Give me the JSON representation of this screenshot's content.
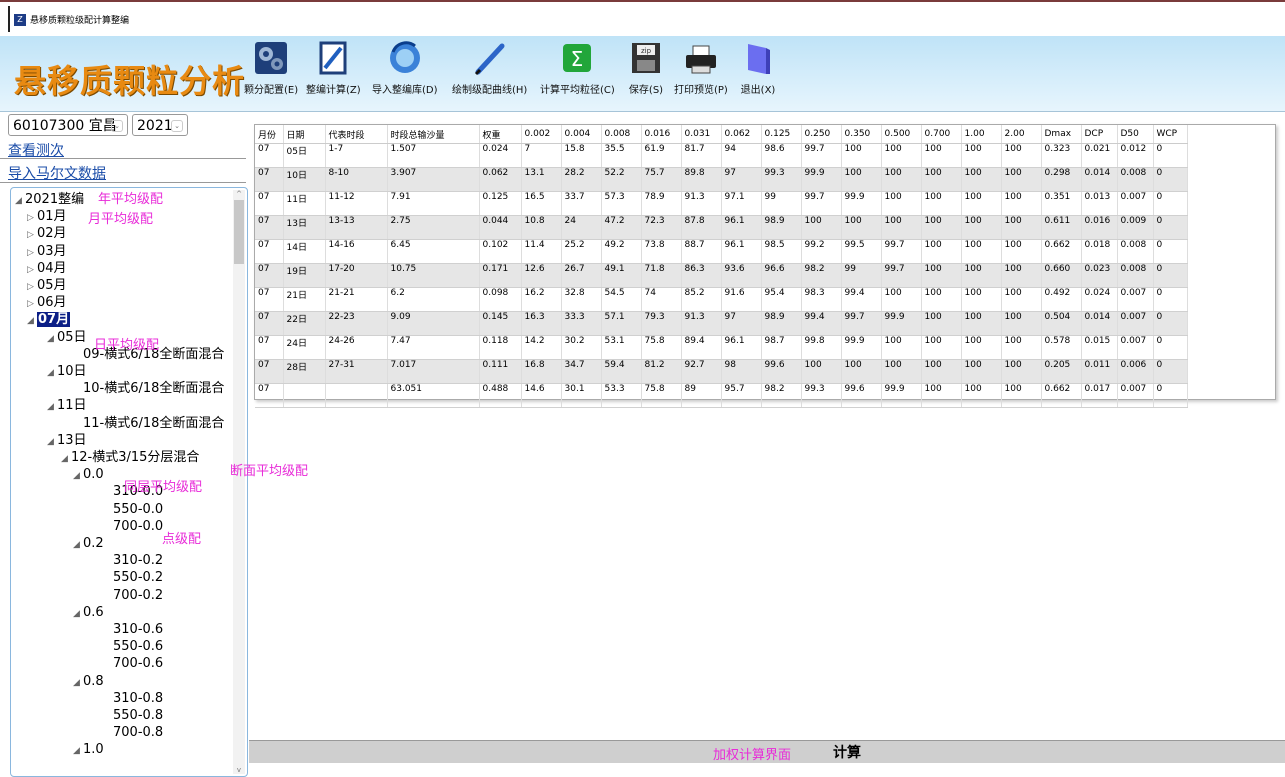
{
  "window": {
    "title": "悬移质颗粒级配计算整编"
  },
  "app_title": "悬移质颗粒分析",
  "toolbar": [
    {
      "id": "config",
      "label": "颗分配置(E)",
      "icon": "gear-cube-icon"
    },
    {
      "id": "compile",
      "label": "整编计算(Z)",
      "icon": "document-edit-icon"
    },
    {
      "id": "import",
      "label": "导入整编库(D)",
      "icon": "refresh-globe-icon"
    },
    {
      "id": "curve",
      "label": "绘制级配曲线(H)",
      "icon": "pen-icon"
    },
    {
      "id": "avg",
      "label": "计算平均粒径(C)",
      "icon": "sigma-icon"
    },
    {
      "id": "save",
      "label": "保存(S)",
      "icon": "floppy-zip-icon"
    },
    {
      "id": "print",
      "label": "打印预览(P)",
      "icon": "printer-icon"
    },
    {
      "id": "exit",
      "label": "退出(X)",
      "icon": "exit-book-icon"
    }
  ],
  "station": "60107300 宜昌",
  "year": "2021",
  "links": {
    "view_measure": "查看测次",
    "import_malvern": "导入马尔文数据"
  },
  "tree": [
    {
      "label": "2021整编",
      "exp": "◢",
      "level": 0
    },
    {
      "label": "01月",
      "exp": "▷",
      "level": 1
    },
    {
      "label": "02月",
      "exp": "▷",
      "level": 1
    },
    {
      "label": "03月",
      "exp": "▷",
      "level": 1
    },
    {
      "label": "04月",
      "exp": "▷",
      "level": 1
    },
    {
      "label": "05月",
      "exp": "▷",
      "level": 1
    },
    {
      "label": "06月",
      "exp": "▷",
      "level": 1
    },
    {
      "label": "07月",
      "exp": "◢",
      "level": 1,
      "selected": true
    },
    {
      "label": "05日",
      "exp": "◢",
      "level": 2
    },
    {
      "label": "09-横式6/18全断面混合",
      "exp": "",
      "level": 3
    },
    {
      "label": "10日",
      "exp": "◢",
      "level": 2
    },
    {
      "label": "10-横式6/18全断面混合",
      "exp": "",
      "level": 3
    },
    {
      "label": "11日",
      "exp": "◢",
      "level": 2
    },
    {
      "label": "11-横式6/18全断面混合",
      "exp": "",
      "level": 3
    },
    {
      "label": "13日",
      "exp": "◢",
      "level": 2
    },
    {
      "label": "12-横式3/15分层混合",
      "exp": "◢",
      "level": 3
    },
    {
      "label": "0.0",
      "exp": "◢",
      "level": 4
    },
    {
      "label": "310-0.0",
      "exp": "",
      "level": 5
    },
    {
      "label": "550-0.0",
      "exp": "",
      "level": 5
    },
    {
      "label": "700-0.0",
      "exp": "",
      "level": 5
    },
    {
      "label": "0.2",
      "exp": "◢",
      "level": 4
    },
    {
      "label": "310-0.2",
      "exp": "",
      "level": 5
    },
    {
      "label": "550-0.2",
      "exp": "",
      "level": 5
    },
    {
      "label": "700-0.2",
      "exp": "",
      "level": 5
    },
    {
      "label": "0.6",
      "exp": "◢",
      "level": 4
    },
    {
      "label": "310-0.6",
      "exp": "",
      "level": 5
    },
    {
      "label": "550-0.6",
      "exp": "",
      "level": 5
    },
    {
      "label": "700-0.6",
      "exp": "",
      "level": 5
    },
    {
      "label": "0.8",
      "exp": "◢",
      "level": 4
    },
    {
      "label": "310-0.8",
      "exp": "",
      "level": 5
    },
    {
      "label": "550-0.8",
      "exp": "",
      "level": 5
    },
    {
      "label": "700-0.8",
      "exp": "",
      "level": 5
    },
    {
      "label": "1.0",
      "exp": "◢",
      "level": 4
    }
  ],
  "annotations": {
    "year_avg": "年平均级配",
    "month_avg": "月平均级配",
    "day_avg": "日平均级配",
    "section_avg": "断面平均级配",
    "layer_avg": "同层平均级配",
    "point": "点级配",
    "weighted": "加权计算界面"
  },
  "table": {
    "headers": [
      "月份",
      "日期",
      "代表时段",
      "时段总输沙量",
      "权重",
      "0.002",
      "0.004",
      "0.008",
      "0.016",
      "0.031",
      "0.062",
      "0.125",
      "0.250",
      "0.350",
      "0.500",
      "0.700",
      "1.00",
      "2.00",
      "Dmax",
      "DCP",
      "D50",
      "WCP"
    ],
    "rows": [
      [
        "07",
        "05日",
        "1-7",
        "1.507",
        "0.024",
        "7",
        "15.8",
        "35.5",
        "61.9",
        "81.7",
        "94",
        "98.6",
        "99.7",
        "100",
        "100",
        "100",
        "100",
        "100",
        "0.323",
        "0.021",
        "0.012",
        "0"
      ],
      [
        "07",
        "10日",
        "8-10",
        "3.907",
        "0.062",
        "13.1",
        "28.2",
        "52.2",
        "75.7",
        "89.8",
        "97",
        "99.3",
        "99.9",
        "100",
        "100",
        "100",
        "100",
        "100",
        "0.298",
        "0.014",
        "0.008",
        "0"
      ],
      [
        "07",
        "11日",
        "11-12",
        "7.91",
        "0.125",
        "16.5",
        "33.7",
        "57.3",
        "78.9",
        "91.3",
        "97.1",
        "99",
        "99.7",
        "99.9",
        "100",
        "100",
        "100",
        "100",
        "0.351",
        "0.013",
        "0.007",
        "0"
      ],
      [
        "07",
        "13日",
        "13-13",
        "2.75",
        "0.044",
        "10.8",
        "24",
        "47.2",
        "72.3",
        "87.8",
        "96.1",
        "98.9",
        "100",
        "100",
        "100",
        "100",
        "100",
        "100",
        "0.611",
        "0.016",
        "0.009",
        "0"
      ],
      [
        "07",
        "14日",
        "14-16",
        "6.45",
        "0.102",
        "11.4",
        "25.2",
        "49.2",
        "73.8",
        "88.7",
        "96.1",
        "98.5",
        "99.2",
        "99.5",
        "99.7",
        "100",
        "100",
        "100",
        "0.662",
        "0.018",
        "0.008",
        "0"
      ],
      [
        "07",
        "19日",
        "17-20",
        "10.75",
        "0.171",
        "12.6",
        "26.7",
        "49.1",
        "71.8",
        "86.3",
        "93.6",
        "96.6",
        "98.2",
        "99",
        "99.7",
        "100",
        "100",
        "100",
        "0.660",
        "0.023",
        "0.008",
        "0"
      ],
      [
        "07",
        "21日",
        "21-21",
        "6.2",
        "0.098",
        "16.2",
        "32.8",
        "54.5",
        "74",
        "85.2",
        "91.6",
        "95.4",
        "98.3",
        "99.4",
        "100",
        "100",
        "100",
        "100",
        "0.492",
        "0.024",
        "0.007",
        "0"
      ],
      [
        "07",
        "22日",
        "22-23",
        "9.09",
        "0.145",
        "16.3",
        "33.3",
        "57.1",
        "79.3",
        "91.3",
        "97",
        "98.9",
        "99.4",
        "99.7",
        "99.9",
        "100",
        "100",
        "100",
        "0.504",
        "0.014",
        "0.007",
        "0"
      ],
      [
        "07",
        "24日",
        "24-26",
        "7.47",
        "0.118",
        "14.2",
        "30.2",
        "53.1",
        "75.8",
        "89.4",
        "96.1",
        "98.7",
        "99.8",
        "99.9",
        "100",
        "100",
        "100",
        "100",
        "0.578",
        "0.015",
        "0.007",
        "0"
      ],
      [
        "07",
        "28日",
        "27-31",
        "7.017",
        "0.111",
        "16.8",
        "34.7",
        "59.4",
        "81.2",
        "92.7",
        "98",
        "99.6",
        "100",
        "100",
        "100",
        "100",
        "100",
        "100",
        "0.205",
        "0.011",
        "0.006",
        "0"
      ],
      [
        "07",
        "",
        "",
        "63.051",
        "0.488",
        "14.6",
        "30.1",
        "53.3",
        "75.8",
        "89",
        "95.7",
        "98.2",
        "99.3",
        "99.6",
        "99.9",
        "100",
        "100",
        "100",
        "0.662",
        "0.017",
        "0.007",
        "0"
      ]
    ]
  },
  "calc_button": "计算",
  "colors": {
    "annotation": "#e82bd8",
    "app_title": "#e88a12",
    "selection": "#0b1e86"
  }
}
